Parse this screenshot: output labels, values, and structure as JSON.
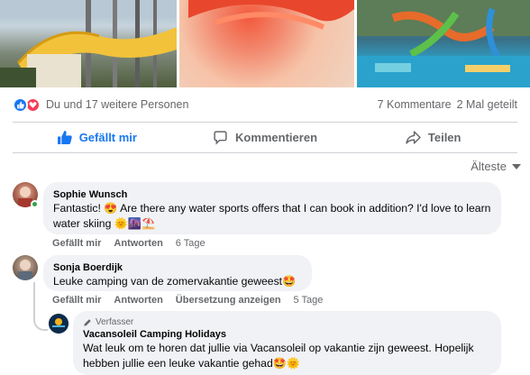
{
  "reactions": {
    "text": "Du und 17 weitere Personen",
    "comments_count": "7 Kommentare",
    "shares_count": "2 Mal geteilt",
    "icons": [
      "like-icon",
      "love-icon"
    ],
    "colors": {
      "like": "#1877f2",
      "love": "#f33e58"
    }
  },
  "actions": {
    "like_label": "Gefällt mir",
    "comment_label": "Kommentieren",
    "share_label": "Teilen"
  },
  "sort": {
    "label": "Älteste"
  },
  "comments": [
    {
      "author": "Sophie Wunsch",
      "text": "Fantastic! 😍 Are there any water sports offers that I can book in addition? I'd love to learn water skiing 🌞🌆⛱️",
      "like_label": "Gefällt mir",
      "reply_label": "Antworten",
      "time": "6 Tage"
    },
    {
      "author": "Sonja Boerdijk",
      "text": "Leuke camping van de zomervakantie geweest🤩",
      "like_label": "Gefällt mir",
      "reply_label": "Antworten",
      "translate_label": "Übersetzung anzeigen",
      "time": "5 Tage"
    }
  ],
  "reply": {
    "badge": "Verfasser",
    "author": "Vacansoleil Camping Holidays",
    "text": "Wat leuk om te horen dat jullie via Vacansoleil op vakantie zijn geweest. Hopelijk hebben jullie een leuke vakantie gehad🤩🌞"
  }
}
